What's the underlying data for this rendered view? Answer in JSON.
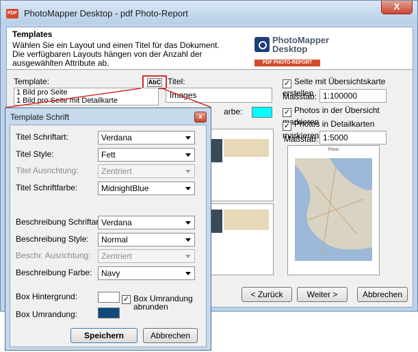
{
  "window": {
    "title": "PhotoMapper Desktop - pdf Photo-Report",
    "app_icon": "pdf-icon",
    "close_label": "X"
  },
  "header": {
    "title": "Templates",
    "description": "Wählen Sie ein Layout und einen Titel für das Dokument. Die verfügbaren Layouts hängen von der Anzahl der ausgewählten Attribute ab.",
    "logo_line1": "PhotoMapper",
    "logo_line2": "Desktop",
    "logo_tag": "PDF PHOTO-REPORT"
  },
  "template": {
    "label": "Template:",
    "items": [
      "1 Bild pro Seite",
      "1 Bild pro Seite mit Detailkarte"
    ],
    "font_button_label": "AbC"
  },
  "titel": {
    "label": "Titel:",
    "value": "Images"
  },
  "farbe": {
    "label": "arbe:",
    "color": "#00ffff"
  },
  "options": {
    "overview_map": {
      "label": "Seite mit Übersichtskarte erstellen",
      "checked": true
    },
    "massstab1": {
      "label": "Maßstab:",
      "value": "1:100000"
    },
    "mark_overview": {
      "label": "Photos in der Übersicht markieren",
      "checked": true
    },
    "mark_detail": {
      "label": "Photos in Detailkarten markieren",
      "checked": true
    },
    "massstab2": {
      "label": "Maßstab:",
      "value": "1:5000"
    }
  },
  "preview": {
    "page_title": "Photo"
  },
  "nav": {
    "back": "< Zurück",
    "next": "Weiter >",
    "cancel": "Abbrechen"
  },
  "dialog": {
    "title": "Template Schrift",
    "close_label": "x",
    "rows": [
      {
        "label": "Titel Schriftart:",
        "value": "Verdana",
        "enabled": true
      },
      {
        "label": "Titel Style:",
        "value": "Fett",
        "enabled": true
      },
      {
        "label": "Titel Ausrichtung:",
        "value": "Zentriert",
        "enabled": false
      },
      {
        "label": "Titel Schriftfarbe:",
        "value": "MidnightBlue",
        "enabled": true
      },
      {
        "label": "Beschreibung Schriftart",
        "value": "Verdana",
        "enabled": true
      },
      {
        "label": "Beschreibung Style:",
        "value": "Normal",
        "enabled": true
      },
      {
        "label": "Beschr. Ausrichtung:",
        "value": "Zentriert",
        "enabled": false
      },
      {
        "label": "Beschreibung Farbe:",
        "value": "Navy",
        "enabled": true
      }
    ],
    "box_bg": {
      "label": "Box Hintergrund:",
      "color": "#ffffff"
    },
    "box_border": {
      "label": "Box Umrandung:",
      "color": "#0f4a7a"
    },
    "round_checkbox": {
      "label": "Box Umrandung abrunden",
      "checked": true
    },
    "save": "Speichern",
    "cancel": "Abbrechen"
  },
  "colors": {
    "highlight": "#d42b2b",
    "window_frame": "#bcd3ea",
    "dialog_frame": "#c7d9ec"
  }
}
